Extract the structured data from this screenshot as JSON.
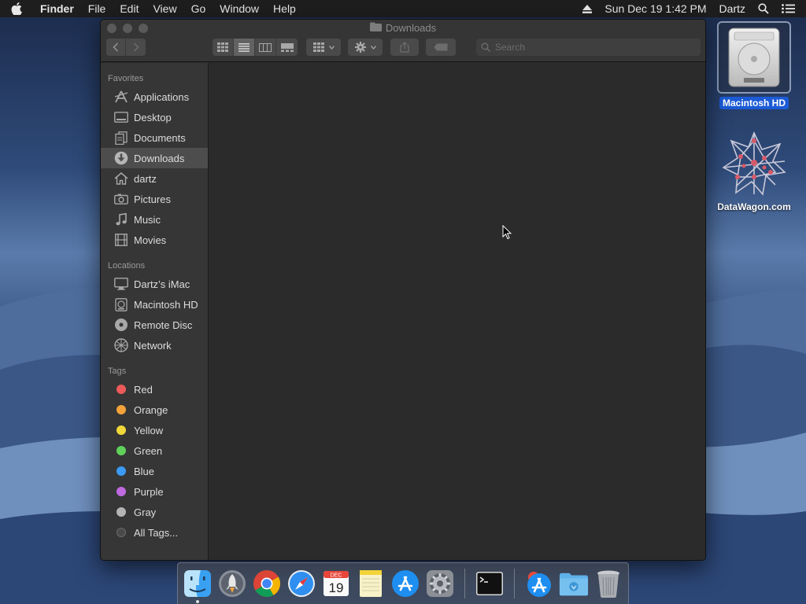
{
  "menubar": {
    "app_name": "Finder",
    "items": [
      "File",
      "Edit",
      "View",
      "Go",
      "Window",
      "Help"
    ],
    "datetime": "Sun Dec 19  1:42 PM",
    "user": "Dartz",
    "icons": [
      "apple-icon",
      "eject-icon",
      "spotlight-icon",
      "notification-center-icon"
    ]
  },
  "desktop": {
    "icons": [
      {
        "label": "Macintosh HD",
        "icon": "hard-drive-icon",
        "selected": true
      },
      {
        "label": "DataWagon.com",
        "icon": "network-volume-icon",
        "selected": false
      }
    ]
  },
  "window": {
    "title": "Downloads",
    "search_placeholder": "Search",
    "toolbar_icons": [
      "back-icon",
      "forward-icon",
      "icon-view-icon",
      "list-view-icon",
      "column-view-icon",
      "gallery-view-icon",
      "group-icon",
      "action-gear-icon",
      "share-icon",
      "tag-icon"
    ],
    "active_view": "list"
  },
  "sidebar": {
    "favorites_header": "Favorites",
    "favorites": [
      {
        "label": "Applications",
        "icon": "applications-icon"
      },
      {
        "label": "Desktop",
        "icon": "desktop-icon"
      },
      {
        "label": "Documents",
        "icon": "documents-icon"
      },
      {
        "label": "Downloads",
        "icon": "downloads-icon",
        "selected": true
      },
      {
        "label": "dartz",
        "icon": "home-icon"
      },
      {
        "label": "Pictures",
        "icon": "pictures-icon"
      },
      {
        "label": "Music",
        "icon": "music-icon"
      },
      {
        "label": "Movies",
        "icon": "movies-icon"
      }
    ],
    "locations_header": "Locations",
    "locations": [
      {
        "label": "Dartz’s iMac",
        "icon": "imac-icon"
      },
      {
        "label": "Macintosh HD",
        "icon": "hard-drive-icon"
      },
      {
        "label": "Remote Disc",
        "icon": "remote-disc-icon"
      },
      {
        "label": "Network",
        "icon": "network-icon"
      }
    ],
    "tags_header": "Tags",
    "tags": [
      {
        "label": "Red",
        "color": "#ec5a5a"
      },
      {
        "label": "Orange",
        "color": "#f3a33a"
      },
      {
        "label": "Yellow",
        "color": "#f1d83a"
      },
      {
        "label": "Green",
        "color": "#5fd15a"
      },
      {
        "label": "Blue",
        "color": "#3b9af3"
      },
      {
        "label": "Purple",
        "color": "#c06ae0"
      },
      {
        "label": "Gray",
        "color": "#b4b4b4"
      },
      {
        "label": "All Tags...",
        "color": "#5a5a5a"
      }
    ]
  },
  "dock": {
    "apps": [
      "finder-icon",
      "launchpad-icon",
      "chrome-icon",
      "safari-icon",
      "calendar-icon",
      "notes-icon",
      "app-store-icon",
      "system-preferences-icon",
      "terminal-icon",
      "applications-stack-icon",
      "downloads-stack-icon",
      "trash-icon"
    ],
    "calendar_month": "DEC",
    "calendar_day": "19"
  },
  "colors": {
    "selection_blue": "#1c5bd6",
    "window_bg": "#2b2b2b",
    "sidebar_bg": "#363636"
  }
}
